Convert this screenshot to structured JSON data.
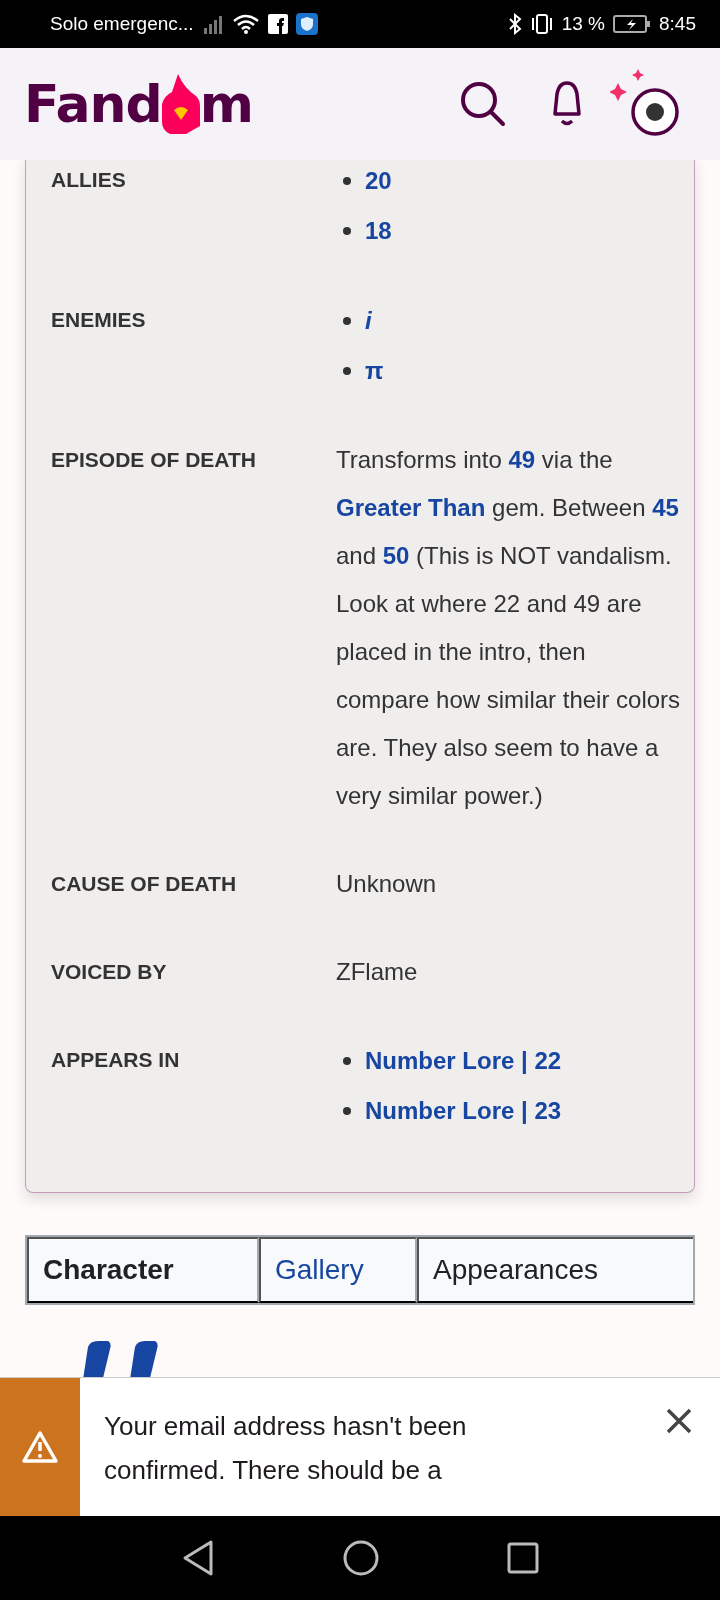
{
  "status_bar": {
    "carrier": "Solo emergenc...",
    "battery": "13 %",
    "time": "8:45"
  },
  "header": {
    "logo_before": "Fand",
    "logo_after": "m"
  },
  "infobox": {
    "rows": [
      {
        "label": "ALLIES",
        "kind": "list",
        "items": [
          "20",
          "18"
        ]
      },
      {
        "label": "ENEMIES",
        "kind": "list",
        "items": [
          "*i*",
          "π"
        ]
      },
      {
        "label": "EPISODE OF DEATH",
        "kind": "text",
        "segments": [
          {
            "text": "Transforms into ",
            "link": false
          },
          {
            "text": "49",
            "link": true
          },
          {
            "text": " via the ",
            "link": false
          },
          {
            "text": "Greater Than",
            "link": true
          },
          {
            "text": " gem. Between ",
            "link": false
          },
          {
            "text": "45",
            "link": true
          },
          {
            "text": " and ",
            "link": false
          },
          {
            "text": "50",
            "link": true
          },
          {
            "text": " (This is NOT vandalism. Look at where 22 and 49 are placed in the intro, then compare how similar their colors are. They also seem to have a very similar power.)",
            "link": false
          }
        ]
      },
      {
        "label": "CAUSE OF DEATH",
        "kind": "text",
        "segments": [
          {
            "text": "Unknown",
            "link": false
          }
        ]
      },
      {
        "label": "VOICED BY",
        "kind": "text",
        "segments": [
          {
            "text": "ZFlame",
            "link": false
          }
        ]
      },
      {
        "label": "APPEARS IN",
        "kind": "list",
        "items": [
          "Number Lore | 22",
          "Number Lore | 23"
        ]
      }
    ]
  },
  "tabs": [
    {
      "label": "Character",
      "selected": true
    },
    {
      "label": "Gallery",
      "selected": false
    },
    {
      "label": "Appearances",
      "selected": false
    }
  ],
  "banner": {
    "message": "Your email address hasn't been confirmed. There should be a"
  }
}
